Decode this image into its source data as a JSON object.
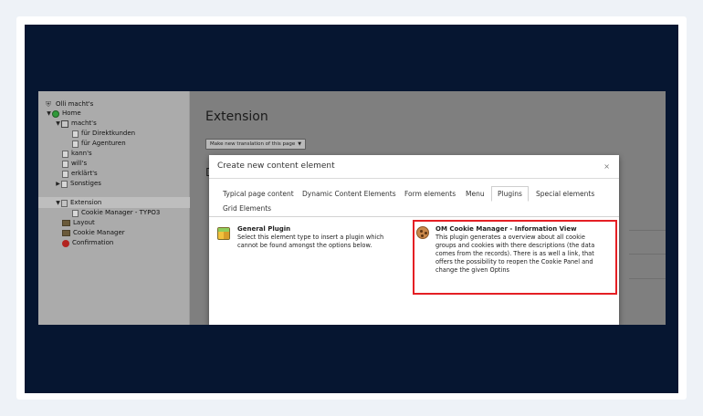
{
  "tree": {
    "items": [
      {
        "label": "Olli macht's",
        "icon": "site-root-icon"
      },
      {
        "label": "Home",
        "icon": "globe-icon"
      },
      {
        "label": "macht's",
        "icon": "page-icon"
      },
      {
        "label": "für Direktkunden",
        "icon": "page-icon"
      },
      {
        "label": "für Agenturen",
        "icon": "page-icon"
      },
      {
        "label": "kann's",
        "icon": "page-icon"
      },
      {
        "label": "will's",
        "icon": "page-icon"
      },
      {
        "label": "erklärt's",
        "icon": "page-icon"
      },
      {
        "label": "Sonstiges",
        "icon": "page-icon"
      },
      {
        "label": "Extension",
        "icon": "page-icon"
      },
      {
        "label": "Cookie Manager - TYPO3",
        "icon": "page-icon"
      },
      {
        "label": "Layout",
        "icon": "folder-icon"
      },
      {
        "label": "Cookie Manager",
        "icon": "folder-icon"
      },
      {
        "label": "Confirmation",
        "icon": "stop-icon"
      }
    ]
  },
  "content": {
    "title": "Extension",
    "translate_select": "Make new translation of this page",
    "bg_letter": "D"
  },
  "modal": {
    "title": "Create new content element",
    "close": "×",
    "tabs": [
      {
        "label": "Typical page content"
      },
      {
        "label": "Dynamic Content Elements"
      },
      {
        "label": "Form elements"
      },
      {
        "label": "Menu"
      },
      {
        "label": "Plugins",
        "active": true
      },
      {
        "label": "Special elements"
      },
      {
        "label": "Grid Elements"
      }
    ],
    "plugins": [
      {
        "name": "General Plugin",
        "lines": [
          "Select this element type to insert a plugin which",
          "cannot be found amongst the options below."
        ],
        "icon": "cube-icon"
      },
      {
        "name": "OM Cookie Manager - Information View",
        "lines": [
          "This plugin generates a overview about all cookie",
          "groups and cookies with there descriptions (the data",
          "comes from the records). There is as well a link, that",
          "offers the possibility to reopen the Cookie Panel and",
          "change the given Optins"
        ],
        "icon": "cookie-icon",
        "highlight_color": "#e41f24"
      }
    ]
  },
  "colors": {
    "background": "#061631",
    "frame": "#ffffff",
    "highlight": "#e41f24"
  }
}
